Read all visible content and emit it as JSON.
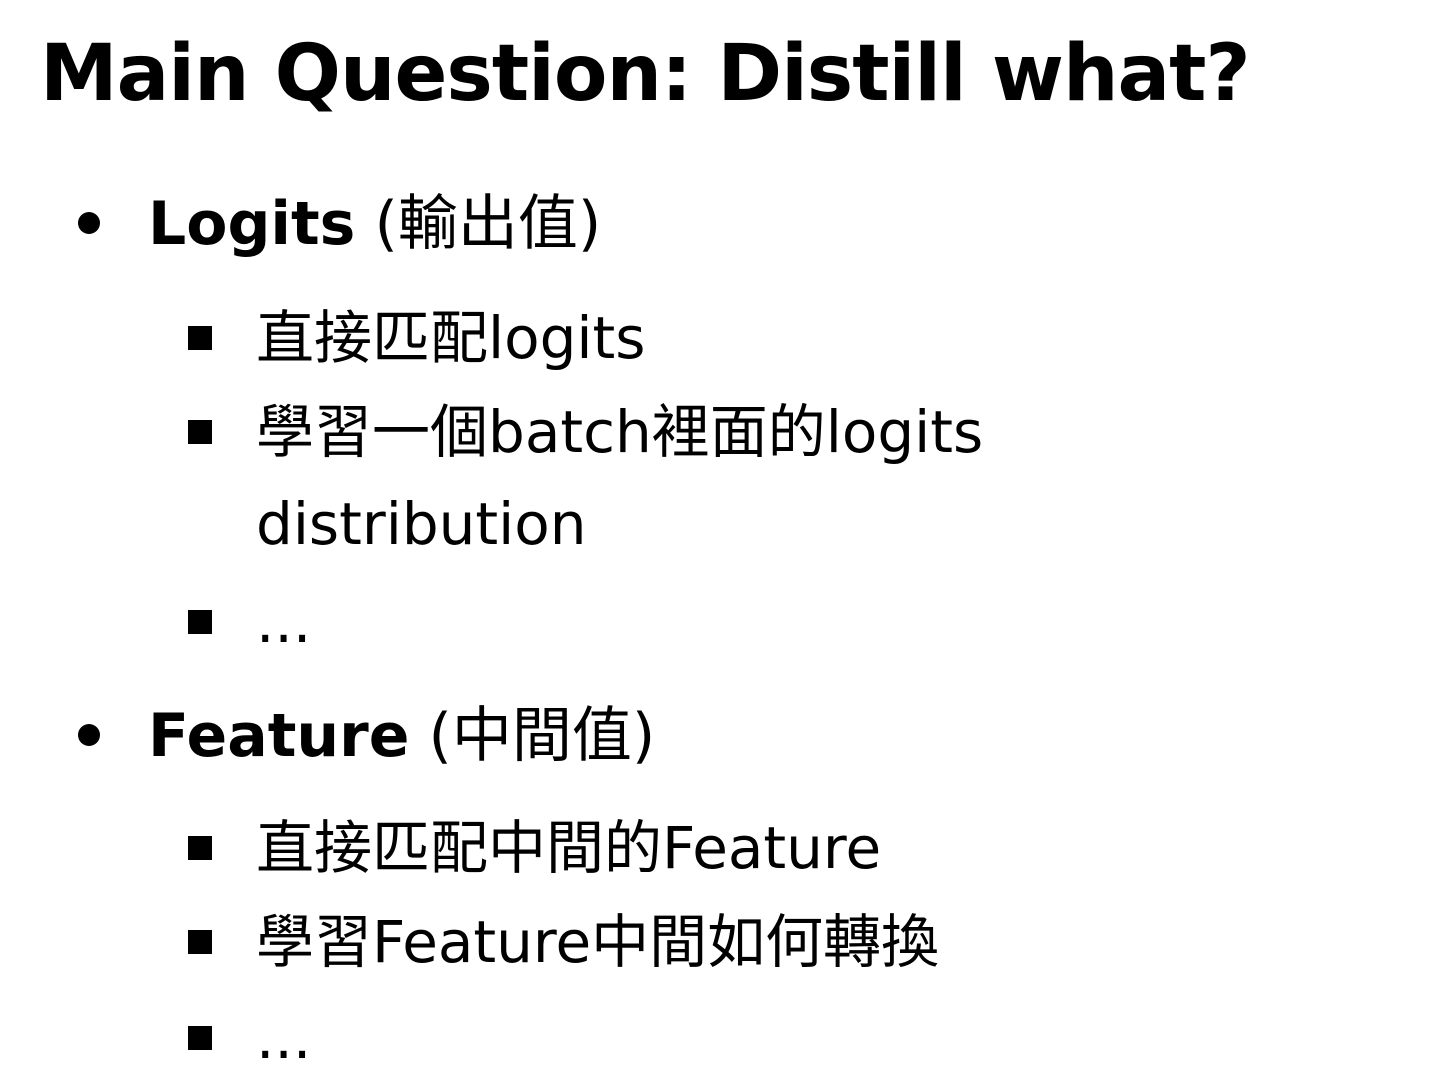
{
  "title": "Main Question: Distill what?",
  "sections": [
    {
      "heading": "Logits",
      "heading_note": "(輸出值)",
      "items": [
        "直接匹配logits",
        "學習一個batch裡面的logits distribution",
        "..."
      ]
    },
    {
      "heading": "Feature",
      "heading_note": "(中間值)",
      "items": [
        "直接匹配中間的Feature",
        "學習Feature中間如何轉換",
        "..."
      ]
    }
  ]
}
